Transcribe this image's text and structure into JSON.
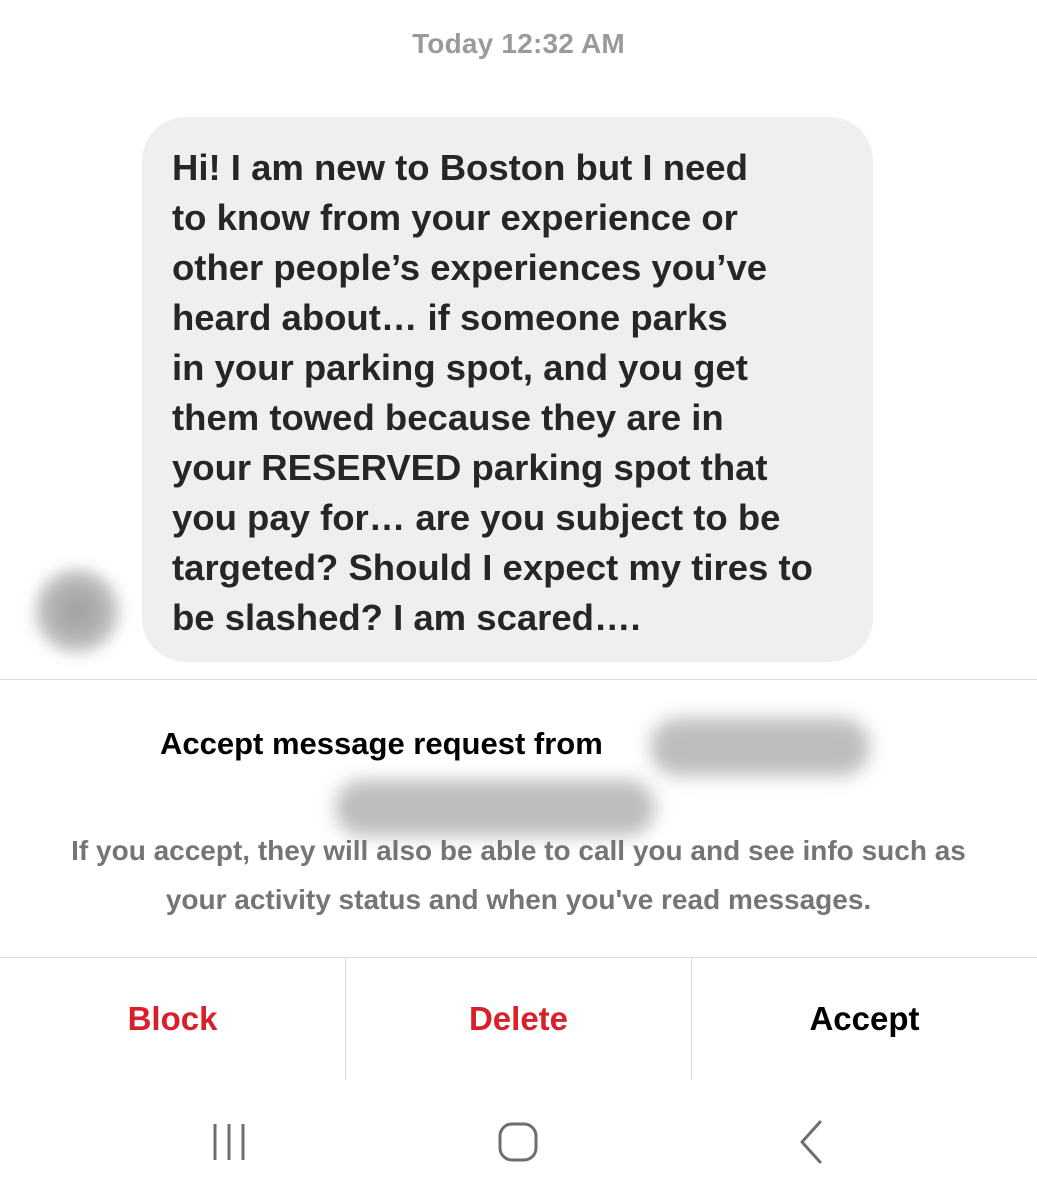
{
  "conversation": {
    "timestamp": "Today 12:32 AM",
    "message_lines": [
      "Hi! I am new to Boston but I need",
      "to know from your experience or",
      "other people’s experiences you’ve",
      "heard about… if someone parks",
      "in your parking spot, and you get",
      "them towed because they are in",
      "your RESERVED parking spot that",
      "you pay for… are you subject to be",
      "targeted? Should I expect my tires to",
      "be slashed? I am scared…."
    ]
  },
  "request": {
    "title": "Accept message request from",
    "info_lines": [
      "If you accept, they will also be able to call you and see info such as",
      "your activity status and when you've read messages."
    ]
  },
  "actions": {
    "block": "Block",
    "delete": "Delete",
    "accept": "Accept"
  },
  "colors": {
    "danger": "#d9202a",
    "bubble": "#efefef",
    "timestamp": "#9a9a9a"
  },
  "nav": {
    "icons": [
      "recent-apps-icon",
      "home-icon",
      "back-icon"
    ]
  }
}
